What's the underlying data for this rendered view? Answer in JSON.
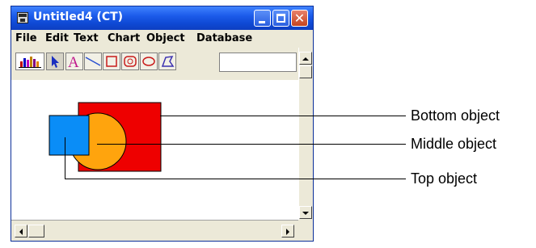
{
  "window": {
    "title": "Untitled4 (CT)",
    "menu": [
      "File",
      "Edit",
      "Text",
      "Chart",
      "Object",
      "Database"
    ],
    "toolbar_text_tool_glyph": "A",
    "toolbar_field_value": ""
  },
  "canvas": {
    "shapes": [
      {
        "name": "bottom-object",
        "kind": "rectangle",
        "color": "#ee0000"
      },
      {
        "name": "middle-object",
        "kind": "circle",
        "color": "#ffa40d"
      },
      {
        "name": "top-object",
        "kind": "square",
        "color": "#0a8df7"
      }
    ]
  },
  "annotations": {
    "bottom": "Bottom object",
    "middle": "Middle object",
    "top": "Top object"
  }
}
